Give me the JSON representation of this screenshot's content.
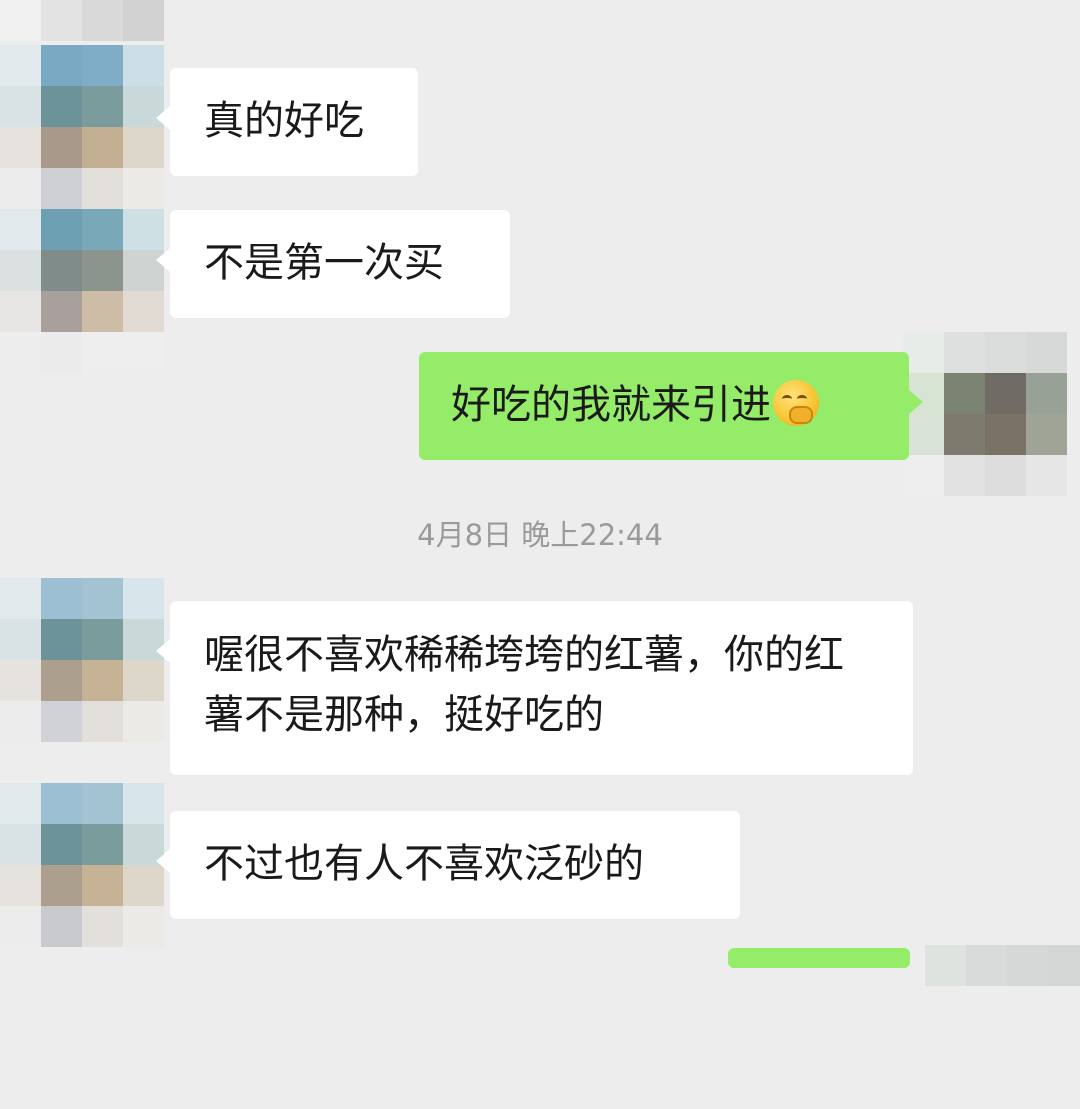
{
  "messages": [
    {
      "side": "in",
      "text": "真的好吃"
    },
    {
      "side": "in",
      "text": "不是第一次买"
    },
    {
      "side": "out",
      "text": "好吃的我就来引进",
      "emoji": "smirk-hand-face"
    },
    {
      "side": "in",
      "text": "喔很不喜欢稀稀垮垮的红薯，你的红薯不是那种，挺好吃的"
    },
    {
      "side": "in",
      "text": "不过也有人不喜欢泛砂的"
    }
  ],
  "timestamp": "4月8日 晚上22:44",
  "colors": {
    "background": "#ededed",
    "incoming_bubble": "#ffffff",
    "outgoing_bubble": "#95ec69",
    "timestamp_text": "#9a9a9a"
  },
  "icons": {
    "emoji": "smirk-hand-face-icon",
    "avatar": "pixelated-avatar"
  }
}
